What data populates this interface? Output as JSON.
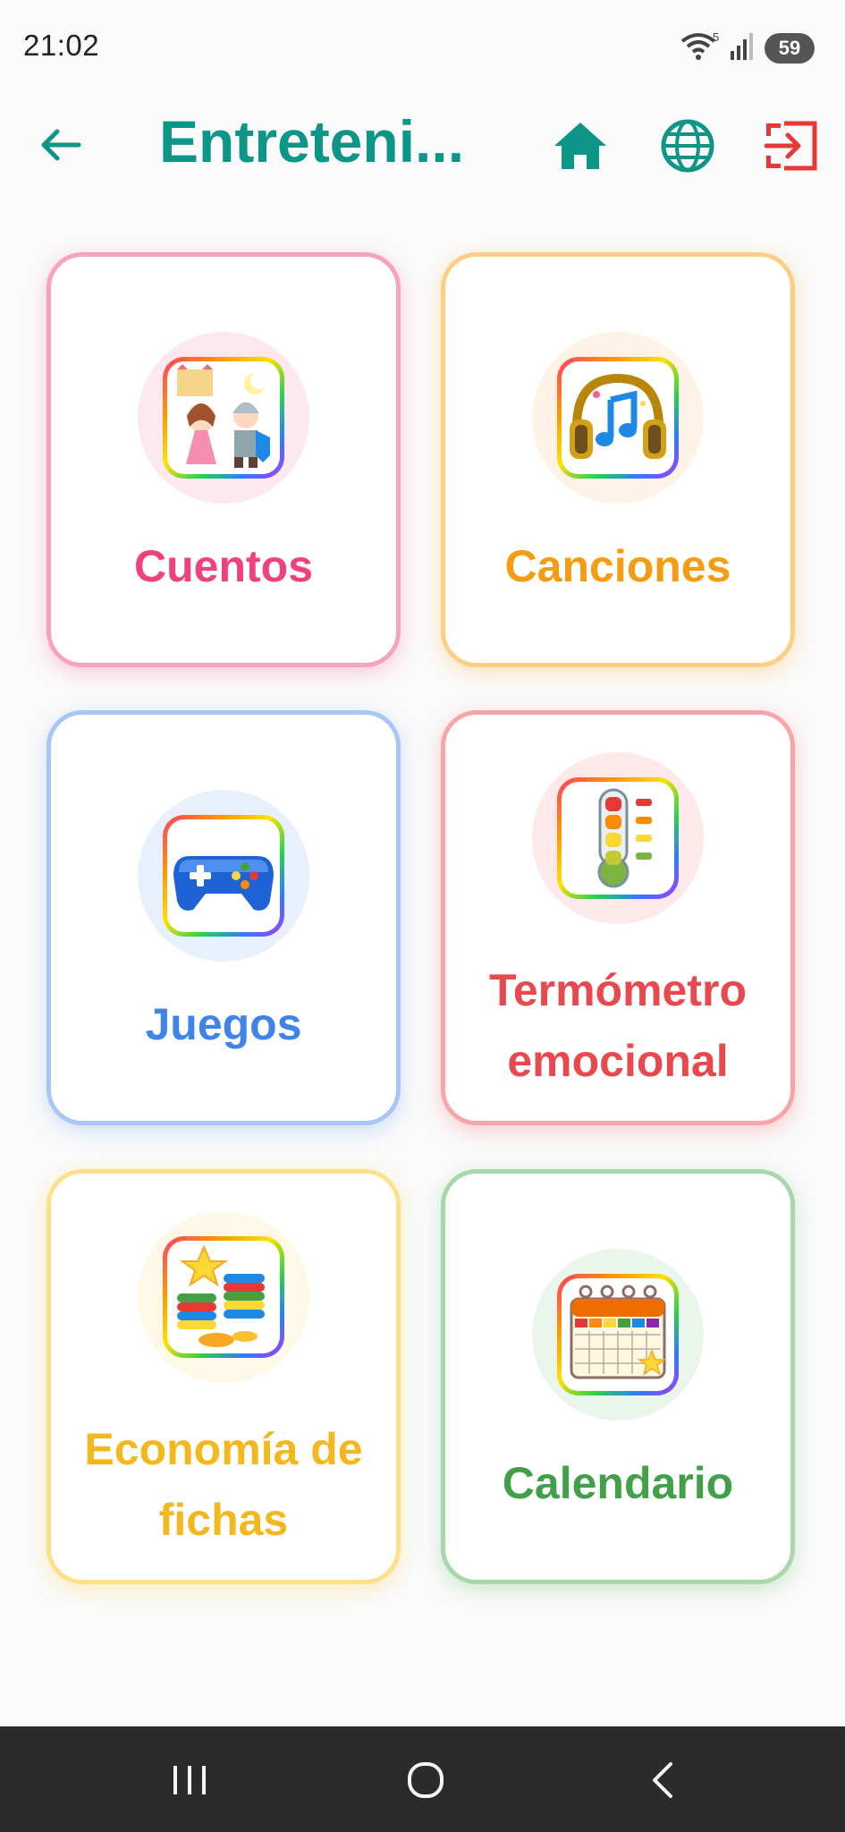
{
  "status_bar": {
    "time": "21:02",
    "wifi_badge": "5",
    "battery": "59"
  },
  "app_bar": {
    "title": "Entreteni...",
    "icons": [
      "back-arrow-icon",
      "home-icon",
      "globe-icon",
      "logout-icon"
    ],
    "title_color": "#0b9688",
    "logout_color": "#e53935"
  },
  "cards": [
    {
      "label": "Cuentos",
      "icon": "fairy-tale-icon",
      "color": "#f0427a",
      "border": "#f7a2c0",
      "circle": "#fde8ef"
    },
    {
      "label": "Canciones",
      "icon": "headphones-icon",
      "color": "#f59c12",
      "border": "#fccf85",
      "circle": "#fef3e6"
    },
    {
      "label": "Juegos",
      "icon": "gamepad-icon",
      "color": "#3f84ea",
      "border": "#a8c6f8",
      "circle": "#e8f0fd"
    },
    {
      "label": "Termómetro emocional",
      "icon": "thermometer-icon",
      "color": "#e8494f",
      "border": "#f8a5a9",
      "circle": "#fde9ea"
    },
    {
      "label": "Economía de fichas",
      "icon": "coins-star-icon",
      "color": "#f4b81f",
      "border": "#fde08a",
      "circle": "#fef8e6"
    },
    {
      "label": "Calendario",
      "icon": "calendar-icon",
      "color": "#43a04a",
      "border": "#a8d8aa",
      "circle": "#eaf5eb"
    }
  ],
  "nav_bar": {
    "buttons": [
      "recents-icon",
      "home-circle-icon",
      "back-chevron-icon"
    ]
  }
}
